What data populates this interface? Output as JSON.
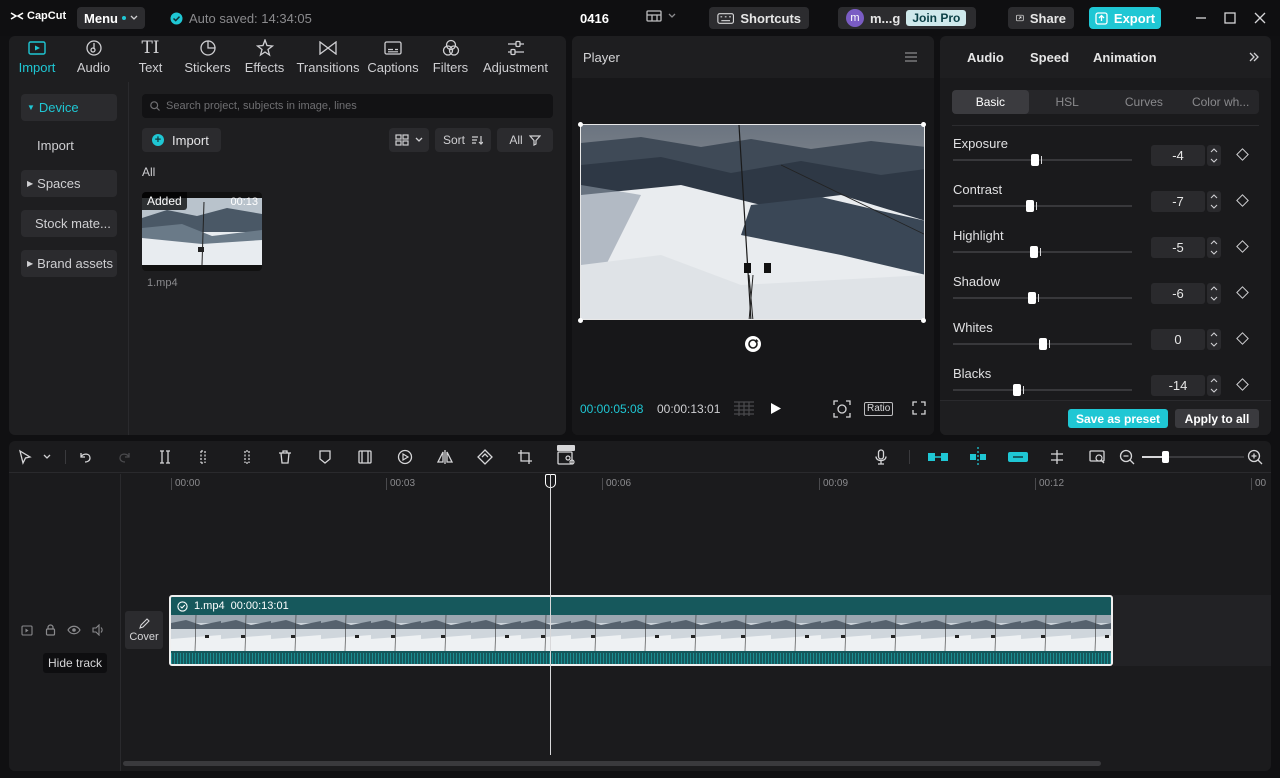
{
  "titlebar": {
    "app_name": "CapCut",
    "menu_label": "Menu",
    "autosave_text": "Auto saved: 14:34:05",
    "project_title": "0416",
    "shortcuts_label": "Shortcuts",
    "user_initial": "m",
    "user_name": "m...g",
    "join_pro_label": "Join Pro",
    "share_label": "Share",
    "export_label": "Export"
  },
  "left_panel": {
    "tabs": [
      {
        "label": "Import",
        "icon": "import-icon",
        "active": true
      },
      {
        "label": "Audio",
        "icon": "audio-icon"
      },
      {
        "label": "Text",
        "icon": "text-icon"
      },
      {
        "label": "Stickers",
        "icon": "stickers-icon"
      },
      {
        "label": "Effects",
        "icon": "effects-icon"
      },
      {
        "label": "Transitions",
        "icon": "transitions-icon"
      },
      {
        "label": "Captions",
        "icon": "captions-icon"
      },
      {
        "label": "Filters",
        "icon": "filters-icon"
      },
      {
        "label": "Adjustment",
        "icon": "adjustment-icon"
      }
    ],
    "sidebar": [
      {
        "label": "Device",
        "active": true
      },
      {
        "label": "Import"
      },
      {
        "label": "Spaces"
      },
      {
        "label": "Stock mate..."
      },
      {
        "label": "Brand assets"
      }
    ],
    "search_placeholder": "Search project, subjects in image, lines",
    "import_button": "Import",
    "sort_label": "Sort",
    "filter_label": "All",
    "section_label": "All",
    "media": [
      {
        "name": "1.mp4",
        "duration": "00:13",
        "badge": "Added"
      }
    ]
  },
  "player": {
    "title": "Player",
    "current_time": "00:00:05:08",
    "total_time": "00:00:13:01",
    "ratio_label": "Ratio"
  },
  "right_panel": {
    "tabs": [
      "Audio",
      "Speed",
      "Animation"
    ],
    "subtabs": [
      "Basic",
      "HSL",
      "Curves",
      "Color wh..."
    ],
    "active_subtab": "Basic",
    "adjustments": [
      {
        "label": "Exposure",
        "value": "-4",
        "level": -4
      },
      {
        "label": "Contrast",
        "value": "-7",
        "level": -7
      },
      {
        "label": "Highlight",
        "value": "-5",
        "level": -5
      },
      {
        "label": "Shadow",
        "value": "-6",
        "level": -6
      },
      {
        "label": "Whites",
        "value": "0",
        "level": 0
      },
      {
        "label": "Blacks",
        "value": "-14",
        "level": -14
      }
    ],
    "save_preset_label": "Save as preset",
    "apply_all_label": "Apply to all"
  },
  "timeline": {
    "ruler_ticks": [
      "00:00",
      "00:03",
      "00:06",
      "00:09",
      "00:12",
      "00"
    ],
    "clip_name": "1.mp4",
    "clip_duration": "00:00:13:01",
    "cover_label": "Cover",
    "hide_track_tooltip": "Hide track"
  },
  "colors": {
    "accent": "#1fc7d4",
    "panel_bg": "#1e1e20",
    "clip_bg": "#16585c"
  }
}
